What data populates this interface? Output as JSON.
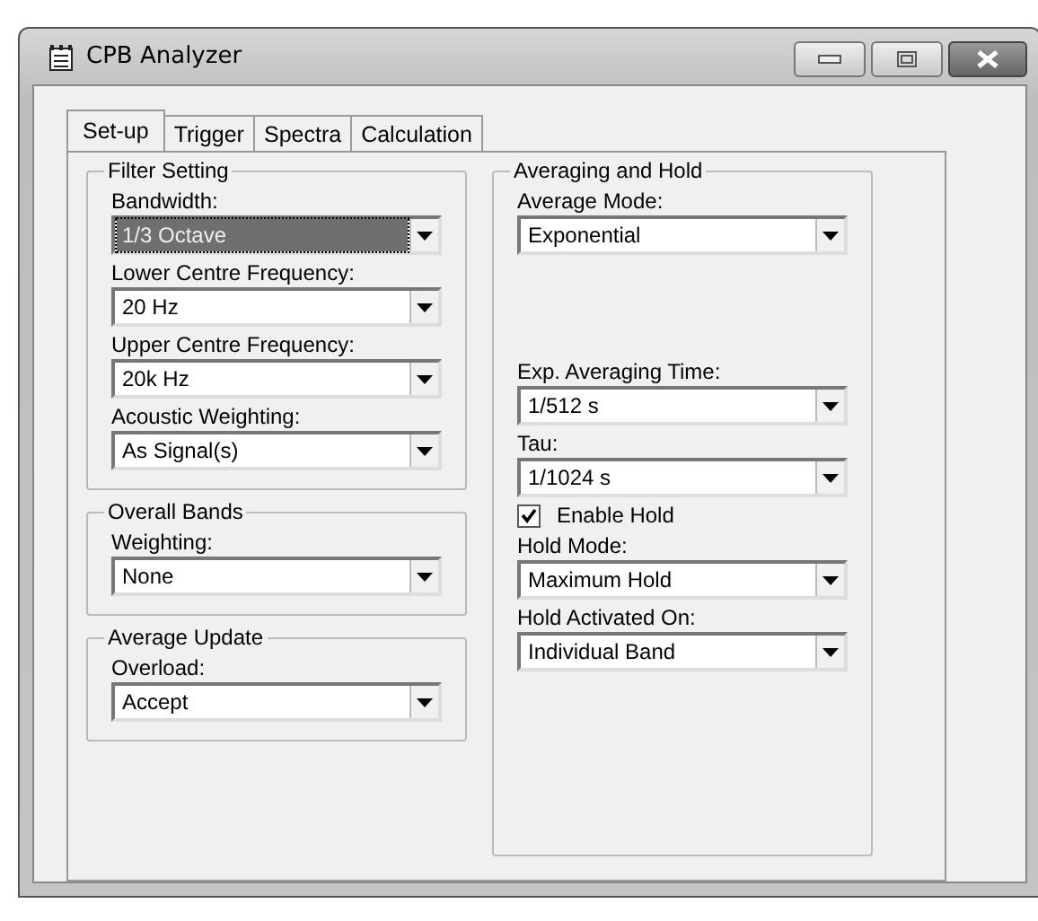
{
  "window": {
    "title": "CPB Analyzer"
  },
  "tabs": [
    {
      "label": "Set-up",
      "selected": true
    },
    {
      "label": "Trigger",
      "selected": false
    },
    {
      "label": "Spectra",
      "selected": false
    },
    {
      "label": "Calculation",
      "selected": false
    }
  ],
  "left_groups": [
    {
      "title": "Filter Setting",
      "fields": [
        {
          "label": "Bandwidth:",
          "value": "1/3 Octave",
          "focused": true
        },
        {
          "label": "Lower Centre Frequency:",
          "value": "20 Hz",
          "focused": false
        },
        {
          "label": "Upper Centre Frequency:",
          "value": "20k Hz",
          "focused": false
        },
        {
          "label": "Acoustic Weighting:",
          "value": "As Signal(s)",
          "focused": false
        }
      ]
    },
    {
      "title": "Overall Bands",
      "fields": [
        {
          "label": "Weighting:",
          "value": "None",
          "focused": false
        }
      ]
    },
    {
      "title": "Average Update",
      "fields": [
        {
          "label": "Overload:",
          "value": "Accept",
          "focused": false
        }
      ]
    }
  ],
  "right_group": {
    "title": "Averaging and Hold",
    "items": [
      {
        "kind": "combo",
        "label": "Average Mode:",
        "value": "Exponential",
        "focused": false
      },
      {
        "kind": "spacer"
      },
      {
        "kind": "combo",
        "label": "Exp. Averaging Time:",
        "value": "1/512 s",
        "focused": false
      },
      {
        "kind": "combo",
        "label": "Tau:",
        "value": "1/1024 s",
        "focused": false
      },
      {
        "kind": "checkbox",
        "label": "Enable Hold",
        "checked": true
      },
      {
        "kind": "combo",
        "label": "Hold Mode:",
        "value": "Maximum Hold",
        "focused": false
      },
      {
        "kind": "combo",
        "label": "Hold Activated On:",
        "value": "Individual Band",
        "focused": false
      }
    ]
  }
}
